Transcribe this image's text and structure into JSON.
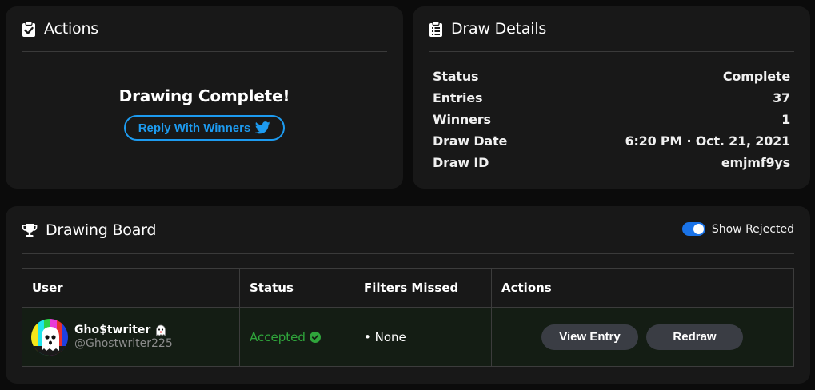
{
  "actions": {
    "title": "Actions",
    "icon": "clipboard-check-icon",
    "status_text": "Drawing Complete!",
    "reply_button": "Reply With Winners",
    "reply_icon": "twitter-icon",
    "accent_color": "#1d9bf0"
  },
  "details": {
    "title": "Draw Details",
    "icon": "clipboard-list-icon",
    "rows": [
      {
        "label": "Status",
        "value": "Complete"
      },
      {
        "label": "Entries",
        "value": "37"
      },
      {
        "label": "Winners",
        "value": "1"
      },
      {
        "label": "Draw Date",
        "value": "6:20 PM · Oct. 21, 2021"
      },
      {
        "label": "Draw ID",
        "value": "emjmf9ys"
      }
    ]
  },
  "board": {
    "title": "Drawing Board",
    "icon": "trophy-icon",
    "show_rejected_label": "Show Rejected",
    "show_rejected_on": true,
    "columns": [
      "User",
      "Status",
      "Filters Missed",
      "Actions"
    ],
    "rows": [
      {
        "name": "Gho$twriter",
        "name_icon": "ghost-icon",
        "handle": "@Ghostwriter225",
        "status": "Accepted",
        "status_color": "#2fa53b",
        "filters": "• None",
        "view_button": "View Entry",
        "redraw_button": "Redraw"
      }
    ]
  }
}
